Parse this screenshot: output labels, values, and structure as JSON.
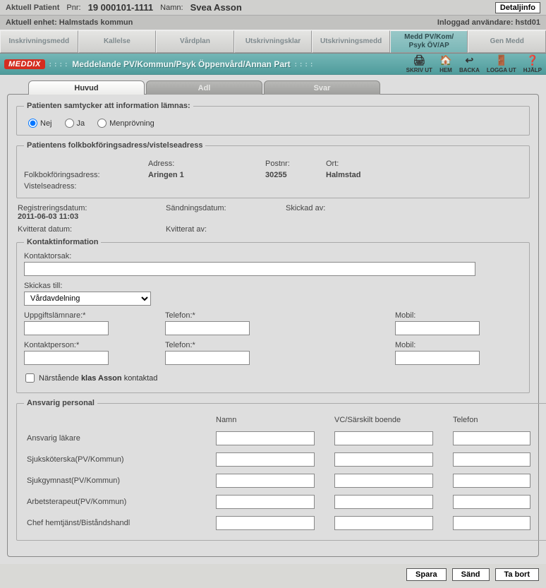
{
  "header": {
    "patient_label": "Aktuell Patient",
    "pnr_label": "Pnr:",
    "pnr_value": "19 000101-1111",
    "name_label": "Namn:",
    "name_value": "Svea Asson",
    "detaljinfo_btn": "Detaljinfo",
    "unit_line": "Aktuell enhet: Halmstads kommun",
    "user_line": "Inloggad användare: hstd01"
  },
  "main_tabs": [
    "Inskrivningsmedd",
    "Kallelse",
    "Vårdplan",
    "Utskrivningsklar",
    "Utskrivningsmedd",
    "Medd PV/Kom/\nPsyk ÖV/AP",
    "Gen Medd"
  ],
  "active_main_tab": 5,
  "titlebar": {
    "logo": "MEDDIX",
    "text": "Meddelande PV/Kommun/Psyk Öppenvård/Annan Part",
    "tools": {
      "print": "SKRIV UT",
      "home": "HEM",
      "back": "BACKA",
      "logout": "LOGGA UT",
      "help": "HJÄLP"
    }
  },
  "sub_tabs": [
    "Huvud",
    "Adl",
    "Svar"
  ],
  "active_sub_tab": 0,
  "consent": {
    "legend": "Patienten samtycker att information lämnas:",
    "options": [
      "Nej",
      "Ja",
      "Menprövning"
    ],
    "selected": 0
  },
  "address": {
    "legend": "Patientens folkbokföringsadress/vistelseadress",
    "row1": {
      "lbl": "",
      "adress_hdr": "Adress:",
      "postnr_hdr": "Postnr:",
      "ort_hdr": "Ort:"
    },
    "folk_lbl": "Folkbokföringsadress:",
    "folk_adress": "Aringen 1",
    "folk_postnr": "30255",
    "folk_ort": "Halmstad",
    "vist_lbl": "Vistelseadress:"
  },
  "dates": {
    "reg_lbl": "Registreringsdatum:",
    "reg_val": "2011-06-03 11:03",
    "send_lbl": "Sändningsdatum:",
    "sent_by_lbl": "Skickad av:",
    "kvitt_lbl": "Kvitterat datum:",
    "kvitt_by_lbl": "Kvitterat av:"
  },
  "kontakt": {
    "legend": "Kontaktinformation",
    "kontaktorsak_lbl": "Kontaktorsak:",
    "kontaktorsak_val": "",
    "skickas_lbl": "Skickas till:",
    "skickas_val": "Vårdavdelning",
    "uppgift_lbl": "Uppgiftslämnare:*",
    "telefon1_lbl": "Telefon:*",
    "mobil1_lbl": "Mobil:",
    "kontaktp_lbl": "Kontaktperson:*",
    "telefon2_lbl": "Telefon:*",
    "mobil2_lbl": "Mobil:",
    "chk_pre": "Närstående",
    "chk_bold": "klas Asson",
    "chk_post": "kontaktad"
  },
  "ansvarig": {
    "legend": "Ansvarig personal",
    "hdr_namn": "Namn",
    "hdr_vc": "VC/Särskilt boende",
    "hdr_tel": "Telefon",
    "rows": [
      "Ansvarig läkare",
      "Sjuksköterska(PV/Kommun)",
      "Sjukgymnast(PV/Kommun)",
      "Arbetsterapeut(PV/Kommun)",
      "Chef hemtjänst/Biståndshandl"
    ]
  },
  "footer": {
    "save": "Spara",
    "send": "Sänd",
    "delete": "Ta bort"
  }
}
